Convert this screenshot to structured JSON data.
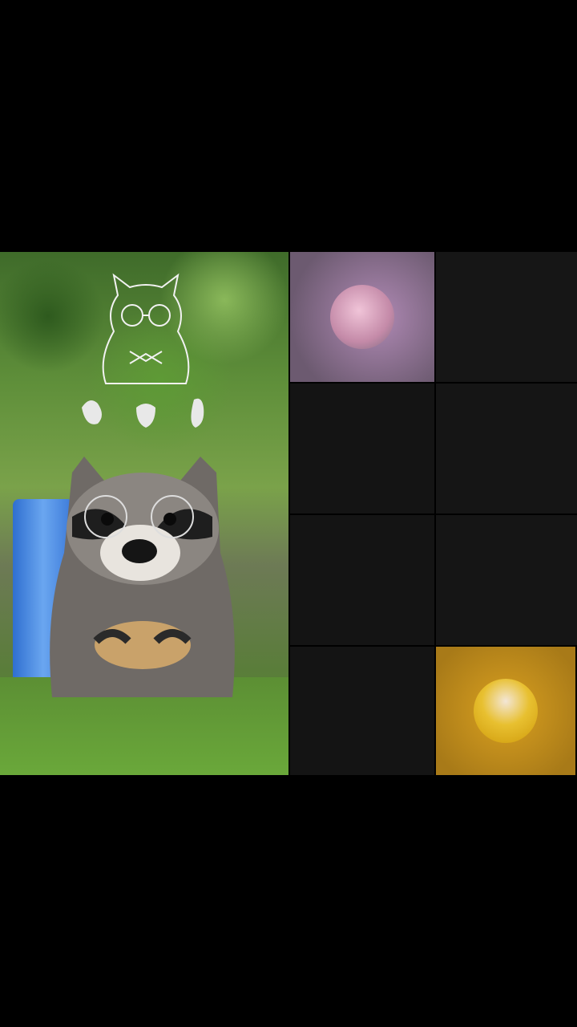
{
  "call": {
    "self_view": {
      "label": "self-camera",
      "effect_icon": "raccoon-mask-icon",
      "gesture_hint_icons": [
        "wave-hand-icon",
        "heart-hands-icon",
        "point-hand-icon"
      ]
    },
    "participants": [
      {
        "slot": 1,
        "video": false,
        "avatar": "avatar-woman-pink-hijab",
        "tile_color": "#8a6a8e",
        "avatar_color": "#d9a6c0"
      },
      {
        "slot": 2,
        "video": false,
        "empty": true,
        "tile_color": "#161616"
      },
      {
        "slot": 3,
        "video": false,
        "empty": true,
        "tile_color": "#141414"
      },
      {
        "slot": 4,
        "video": false,
        "empty": true,
        "tile_color": "#151515"
      },
      {
        "slot": 5,
        "video": false,
        "empty": true,
        "tile_color": "#141414"
      },
      {
        "slot": 6,
        "video": false,
        "empty": true,
        "tile_color": "#151515"
      },
      {
        "slot": 7,
        "video": false,
        "empty": true,
        "tile_color": "#141414"
      },
      {
        "slot": 8,
        "video": false,
        "avatar": "avatar-twin-babies-yellow",
        "tile_color": "#b8860b",
        "avatar_color": "#e8b820"
      }
    ]
  }
}
